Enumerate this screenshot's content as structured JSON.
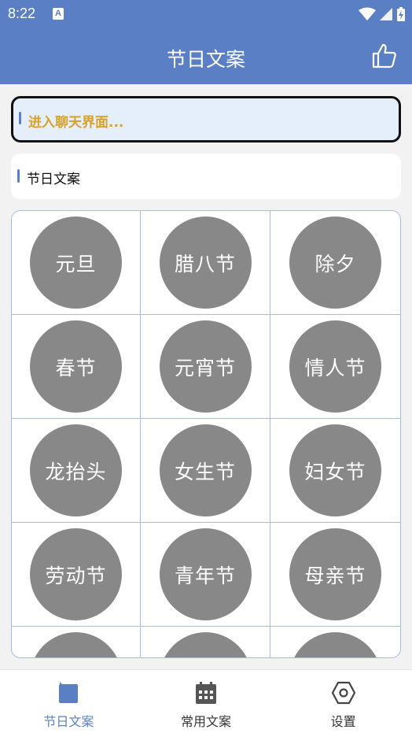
{
  "status_bar": {
    "time": "8:22",
    "notification_icon": "A"
  },
  "app_bar": {
    "title": "节日文案",
    "action_icon": "thumbs-up-icon"
  },
  "chat_entry": {
    "label": "进入聊天界面..."
  },
  "section": {
    "title": "节日文案"
  },
  "festivals": [
    "元旦",
    "腊八节",
    "除夕",
    "春节",
    "元宵节",
    "情人节",
    "龙抬头",
    "女生节",
    "妇女节",
    "劳动节",
    "青年节",
    "母亲节",
    "",
    "",
    ""
  ],
  "bottom_nav": {
    "items": [
      {
        "label": "节日文案",
        "icon": "festival-card-icon",
        "active": true
      },
      {
        "label": "常用文案",
        "icon": "calendar-icon",
        "active": false
      },
      {
        "label": "设置",
        "icon": "hex-gear-icon",
        "active": false
      }
    ]
  },
  "colors": {
    "primary": "#5b7fc4",
    "accent_text": "#d9a12a",
    "circle": "#888888",
    "grid_border": "#a7b9ec"
  }
}
